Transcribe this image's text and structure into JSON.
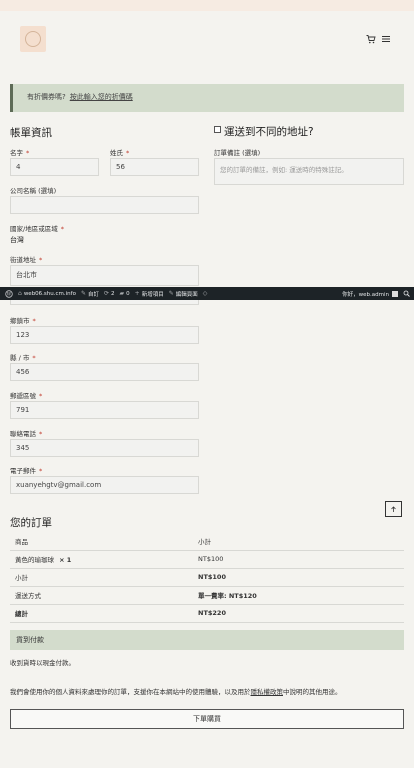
{
  "coupon": {
    "question": "有折價券嗎?",
    "link": "按此輸入您的折價碼"
  },
  "billing": {
    "title": "帳單資訊",
    "first_name": {
      "label": "名字",
      "value": "4"
    },
    "last_name": {
      "label": "姓氏",
      "value": "56"
    },
    "company": {
      "label": "公司名稱 (選填)",
      "value": ""
    },
    "country": {
      "label": "國家/地區或區域",
      "value": "台灣"
    },
    "street": {
      "label": "街道地址",
      "value": "台北市"
    },
    "city": {
      "label": "鄉鎮市",
      "value": "123"
    },
    "county": {
      "label": "縣 / 市",
      "value": "456"
    },
    "postcode": {
      "label": "郵遞區號",
      "value": "791"
    },
    "phone": {
      "label": "聯絡電話",
      "value": "345"
    },
    "email": {
      "label": "電子郵件",
      "value": "xuanyehgtv@gmail.com"
    },
    "required_mark": "*"
  },
  "shipping": {
    "title": "運送到不同的地址?",
    "notes_label": "訂單備註 (選填)",
    "notes_placeholder": "您的訂單的備註，例如: 運送時的特殊註記。"
  },
  "adminbar": {
    "site": "web06.shu.cm.info",
    "customize": "自訂",
    "updates": "2",
    "comments": "0",
    "new": "新增項目",
    "edit": "編輯頁面",
    "greeting": "你好，web.admin"
  },
  "order": {
    "title": "您的訂單",
    "head_product": "商品",
    "head_subtotal": "小計",
    "item_name": "黃色的瑜珈球",
    "item_qty": "× 1",
    "item_price": "NT$100",
    "subtotal_label": "小計",
    "subtotal_value": "NT$100",
    "shipping_label": "運送方式",
    "shipping_value": "單一費率: NT$120",
    "total_label": "總計",
    "total_value": "NT$220"
  },
  "payment": {
    "title": "貨到付款",
    "desc": "收到貨時以現金付款。"
  },
  "privacy": {
    "text_before": "我們會使用你的個人資料來處理你的訂單，支援你在本網站中的使用體驗，以及用於",
    "link": "隱私權政策",
    "text_after": "中說明的其他用途。"
  },
  "submit_label": "下單購買",
  "colors": {
    "accent": "#d3dccc",
    "adminbar": "#1d2327",
    "required": "#c0392b"
  },
  "icons": [
    "cart-icon",
    "menu-icon",
    "wordpress-icon",
    "update-icon",
    "comment-icon",
    "plus-icon",
    "pencil-icon",
    "search-icon",
    "arrow-up-icon"
  ]
}
